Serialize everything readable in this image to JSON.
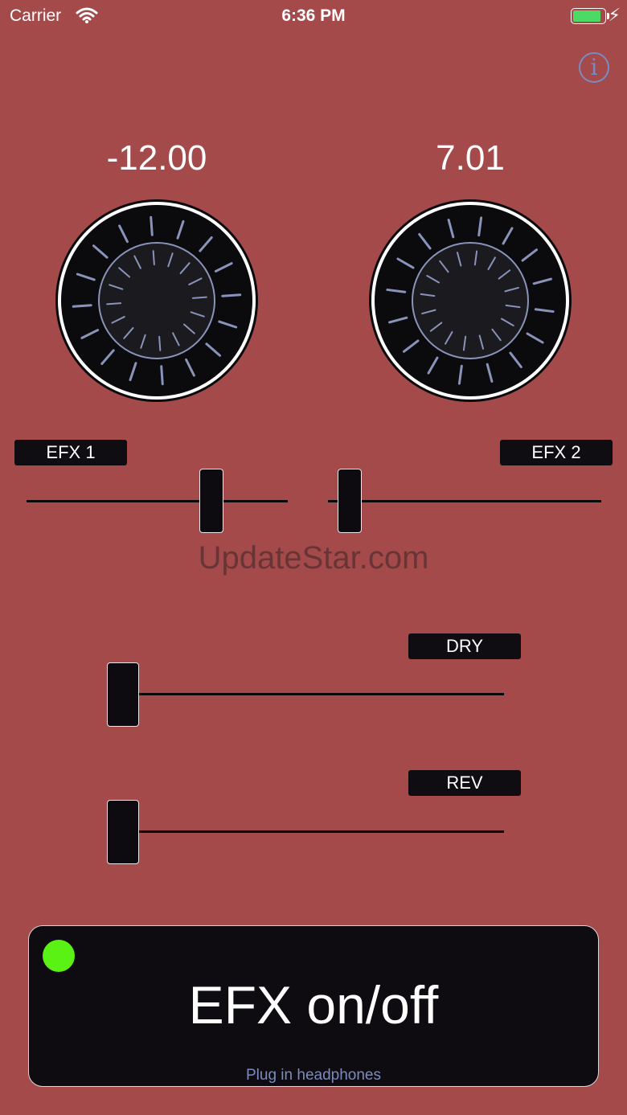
{
  "status_bar": {
    "carrier": "Carrier",
    "time": "6:36 PM",
    "battery_level": 0.95
  },
  "knobs": [
    {
      "readout": "-12.00"
    },
    {
      "readout": "7.01"
    }
  ],
  "efx_sliders": [
    {
      "label": "EFX 1",
      "value": 0.73
    },
    {
      "label": "EFX 2",
      "value": 0.04
    }
  ],
  "mix_sliders": [
    {
      "label": "DRY",
      "value": 0.0
    },
    {
      "label": "REV",
      "value": 0.0
    }
  ],
  "watermark": "UpdateStar.com",
  "efx_button": {
    "label": "EFX on/off",
    "status": "Plug in headphones",
    "led_color": "#5af214"
  },
  "colors": {
    "background": "#a54a4b",
    "accent": "#7a8cbf",
    "panel": "#0e0c11"
  },
  "icons": {
    "info": "info-icon",
    "wifi": "wifi-icon",
    "charging": "bolt-icon"
  }
}
